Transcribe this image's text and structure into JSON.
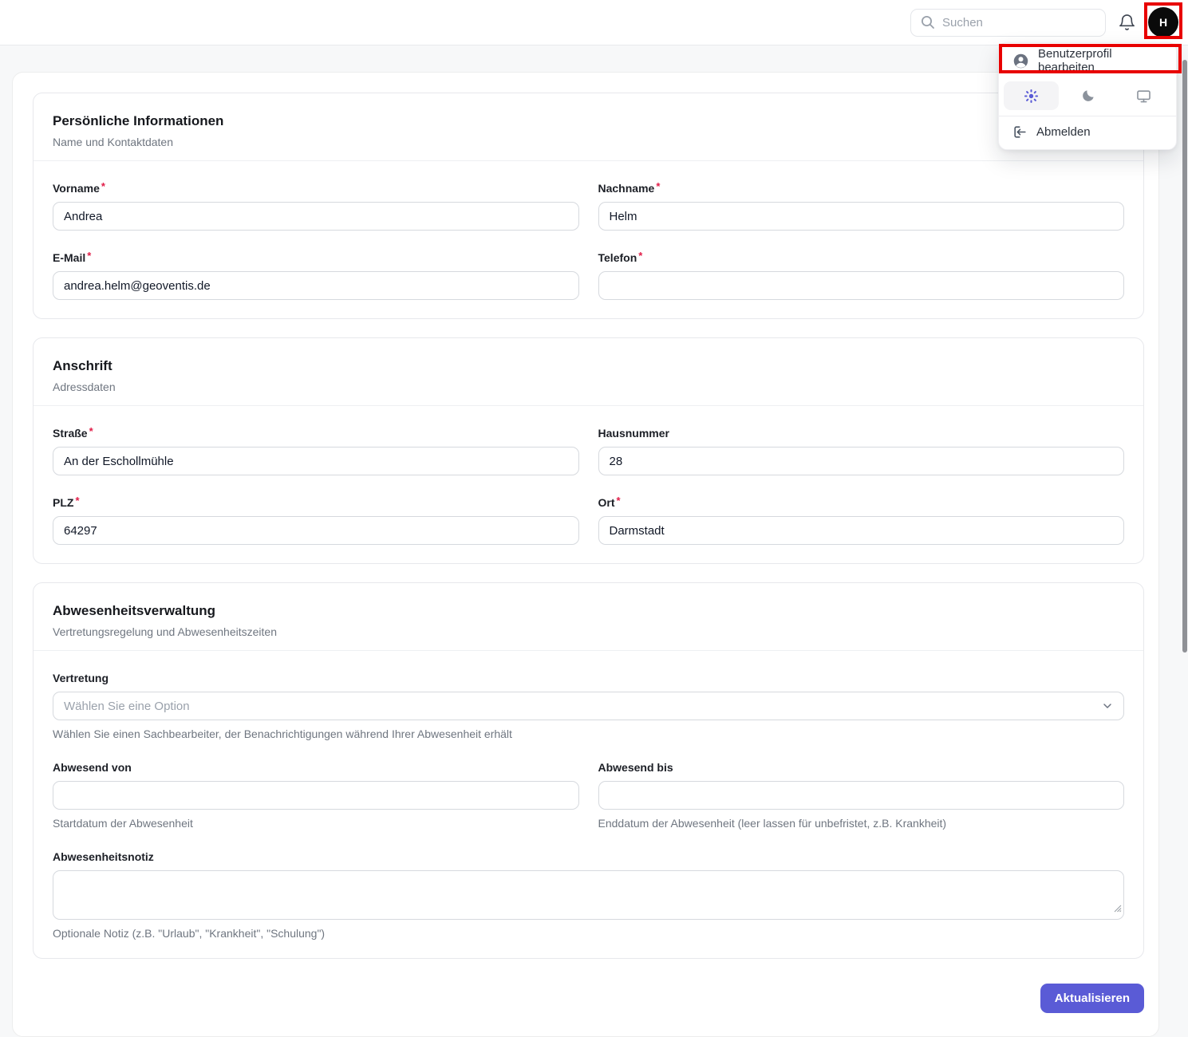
{
  "ui": {
    "required_mark": "*"
  },
  "header": {
    "search_placeholder": "Suchen",
    "avatar_initial": "H"
  },
  "user_menu": {
    "profile_item": "Benutzerprofil bearbeiten",
    "logout_item": "Abmelden",
    "themes": {
      "selected": "light",
      "options": [
        "light",
        "dark",
        "system"
      ]
    }
  },
  "personal": {
    "title": "Persönliche Informationen",
    "subtitle": "Name und Kontaktdaten",
    "fields": {
      "vorname": {
        "label": "Vorname",
        "value": "Andrea",
        "required": true
      },
      "nachname": {
        "label": "Nachname",
        "value": "Helm",
        "required": true
      },
      "email": {
        "label": "E-Mail",
        "value": "andrea.helm@geoventis.de",
        "required": true
      },
      "telefon": {
        "label": "Telefon",
        "value": "",
        "required": true
      }
    }
  },
  "address": {
    "title": "Anschrift",
    "subtitle": "Adressdaten",
    "fields": {
      "strasse": {
        "label": "Straße",
        "value": "An der Eschollmühle",
        "required": true
      },
      "hausnummer": {
        "label": "Hausnummer",
        "value": "28",
        "required": false
      },
      "plz": {
        "label": "PLZ",
        "value": "64297",
        "required": true
      },
      "ort": {
        "label": "Ort",
        "value": "Darmstadt",
        "required": true
      }
    }
  },
  "absence": {
    "title": "Abwesenheitsverwaltung",
    "subtitle": "Vertretungsregelung und Abwesenheitszeiten",
    "vertretung_label": "Vertretung",
    "vertretung_placeholder": "Wählen Sie eine Option",
    "vertretung_help": "Wählen Sie einen Sachbearbeiter, der Benachrichtigungen während Ihrer Abwesenheit erhält",
    "von_label": "Abwesend von",
    "von_value": "",
    "von_help": "Startdatum der Abwesenheit",
    "bis_label": "Abwesend bis",
    "bis_value": "",
    "bis_help": "Enddatum der Abwesenheit (leer lassen für unbefristet, z.B. Krankheit)",
    "notiz_label": "Abwesenheitsnotiz",
    "notiz_value": "",
    "notiz_help": "Optionale Notiz (z.B. \"Urlaub\", \"Krankheit\", \"Schulung\")"
  },
  "footer": {
    "update_label": "Aktualisieren"
  },
  "icons": [
    "search-icon",
    "bell-icon",
    "user-circle-icon",
    "sun-icon",
    "moon-icon",
    "monitor-icon",
    "logout-icon",
    "chevron-down-icon",
    "resize-handle-icon"
  ],
  "colors": {
    "accent": "#5a5bd6",
    "annotation_red": "#e80000",
    "required_red": "#e11d48",
    "avatar_bg": "#0a0a0a",
    "page_bg": "#f7f8f9"
  }
}
